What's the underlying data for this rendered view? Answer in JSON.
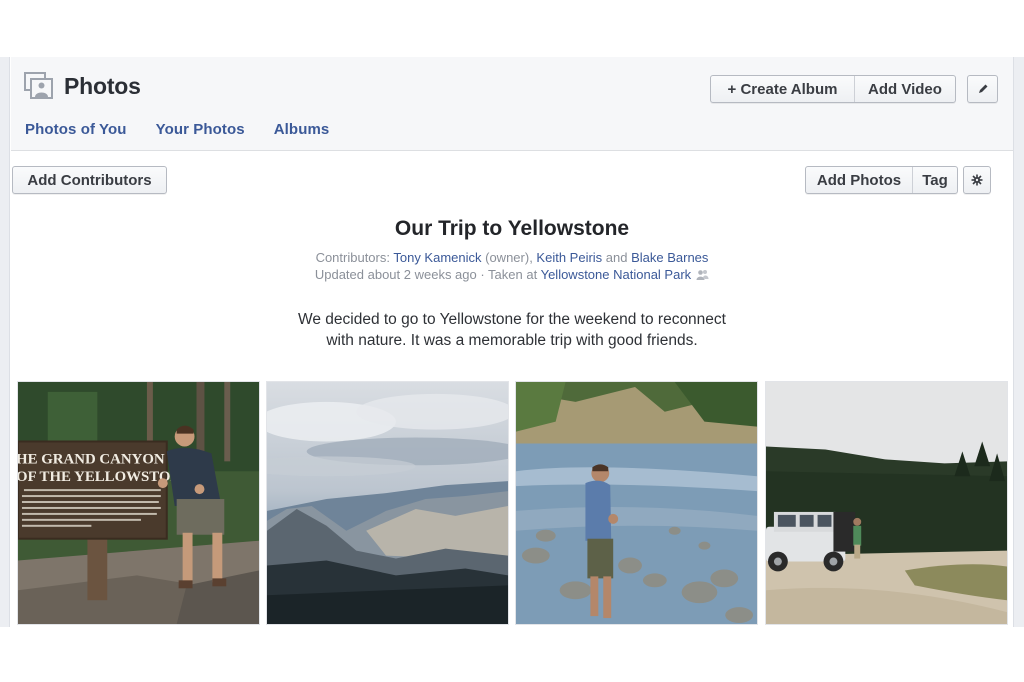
{
  "header": {
    "title": "Photos",
    "icon": "photos-icon",
    "tabs": [
      {
        "label": "Photos of You"
      },
      {
        "label": "Your Photos"
      },
      {
        "label": "Albums"
      }
    ],
    "actions": {
      "create_album": "+ Create Album",
      "add_video": "Add Video",
      "edit_icon": "pencil-icon"
    }
  },
  "toolbar": {
    "add_contributors": "Add Contributors",
    "add_photos": "Add Photos",
    "tag": "Tag",
    "settings_icon": "gear-icon"
  },
  "album": {
    "title": "Our Trip to Yellowstone",
    "contributors_label": "Contributors: ",
    "contributors": [
      {
        "name": "Tony Kamenick",
        "suffix": " (owner), "
      },
      {
        "name": "Keith Peiris",
        "suffix": " and "
      },
      {
        "name": "Blake Barnes",
        "suffix": ""
      }
    ],
    "updated": "Updated about 2 weeks ago · Taken at ",
    "location": "Yellowstone National Park",
    "privacy_icon": "friends-icon",
    "description_line1": "We decided to go to Yellowstone for the weekend to reconnect",
    "description_line2": "with nature. It was a memorable trip with good friends."
  },
  "photos": [
    {
      "subject": "Man giving thumbs up next to 'The Grand Canyon of the Yellowstone' sign",
      "sign_line1": "HE GRAND CANYON",
      "sign_line2": "OF THE YELLOWSTONE"
    },
    {
      "subject": "Mountain range under cloudy sky"
    },
    {
      "subject": "Man wading in a rocky river"
    },
    {
      "subject": "White Jeep parked near a forest on a dirt lot"
    }
  ]
}
